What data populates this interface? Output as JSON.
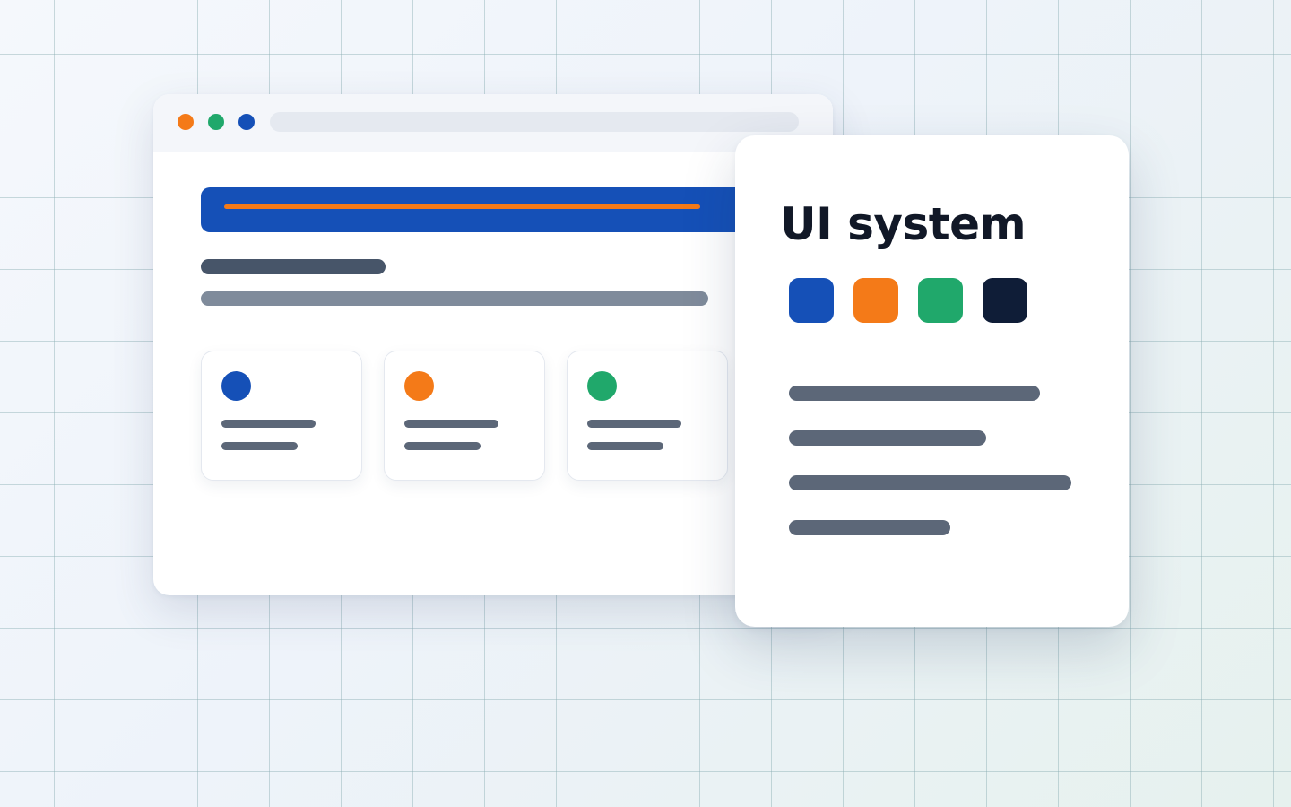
{
  "browser_window": {
    "traffic_lights": [
      "#f47a18",
      "#20a86b",
      "#1550b7"
    ],
    "hero_color": "#1550b7",
    "hero_accent_color": "#f47a18",
    "cards": [
      {
        "icon": "blue-dot-icon",
        "color": "#1550b7"
      },
      {
        "icon": "orange-dot-icon",
        "color": "#f47a18"
      },
      {
        "icon": "green-dot-icon",
        "color": "#20a86b"
      }
    ]
  },
  "panel": {
    "title": "UI system",
    "swatches": [
      {
        "name": "blue",
        "color": "#1550b7"
      },
      {
        "name": "orange",
        "color": "#f47a18"
      },
      {
        "name": "green",
        "color": "#20a86b"
      },
      {
        "name": "navy",
        "color": "#0f1d37"
      }
    ]
  }
}
